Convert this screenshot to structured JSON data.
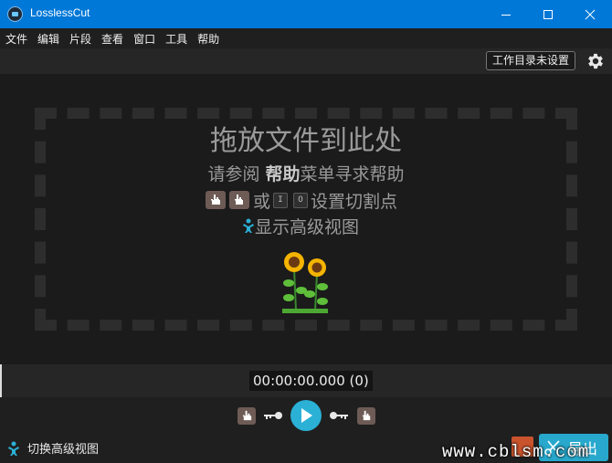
{
  "window": {
    "title": "LosslessCut",
    "minimize_icon": "minimize-icon",
    "maximize_icon": "maximize-icon",
    "close_icon": "close-icon"
  },
  "menu": [
    "文件",
    "编辑",
    "片段",
    "查看",
    "窗口",
    "工具",
    "帮助"
  ],
  "toolbar": {
    "workdir_label": "工作目录未设置",
    "settings_icon": "gear-icon"
  },
  "main": {
    "drop_title": "拖放文件到此处",
    "help_prefix": "请参阅 ",
    "help_bold": "帮助",
    "help_suffix": "菜单寻求帮助",
    "cut_or": "或",
    "kbd_in": "I",
    "kbd_out": "O",
    "cut_suffix": "设置切割点",
    "advanced_label": "显示高级视图"
  },
  "timeline": {
    "timecode": "00:00:00.000 (0)"
  },
  "controls": {
    "toggle_advanced_label": "切换高级视图",
    "export_label": "导出"
  },
  "watermark": "www.cblsm.com",
  "colors": {
    "accent": "#2bb0d6",
    "titlebar": "#0078d7",
    "background": "#1b1b1b"
  }
}
